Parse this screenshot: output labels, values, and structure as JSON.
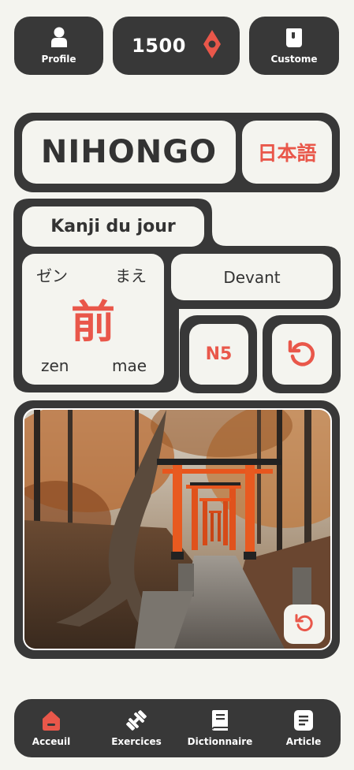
{
  "header": {
    "profile_label": "Profile",
    "points": "1500",
    "custome_label": "Custome"
  },
  "title": {
    "main": "NIHONGO",
    "japanese": "日本語"
  },
  "kanji": {
    "section_title": "Kanji du jour",
    "character": "前",
    "kana_left": "ゼン",
    "kana_right": "まえ",
    "romaji_left": "zen",
    "romaji_right": "mae",
    "meaning": "Devant",
    "level": "N5"
  },
  "image": {
    "icon": "torii-forest-photo"
  },
  "nav": {
    "accueil": "Acceuil",
    "exercices": "Exercices",
    "dictionnaire": "Dictionnaire",
    "article": "Article"
  },
  "colors": {
    "accent": "#e9574a",
    "dark": "#383838",
    "background": "#f4f4ef"
  }
}
